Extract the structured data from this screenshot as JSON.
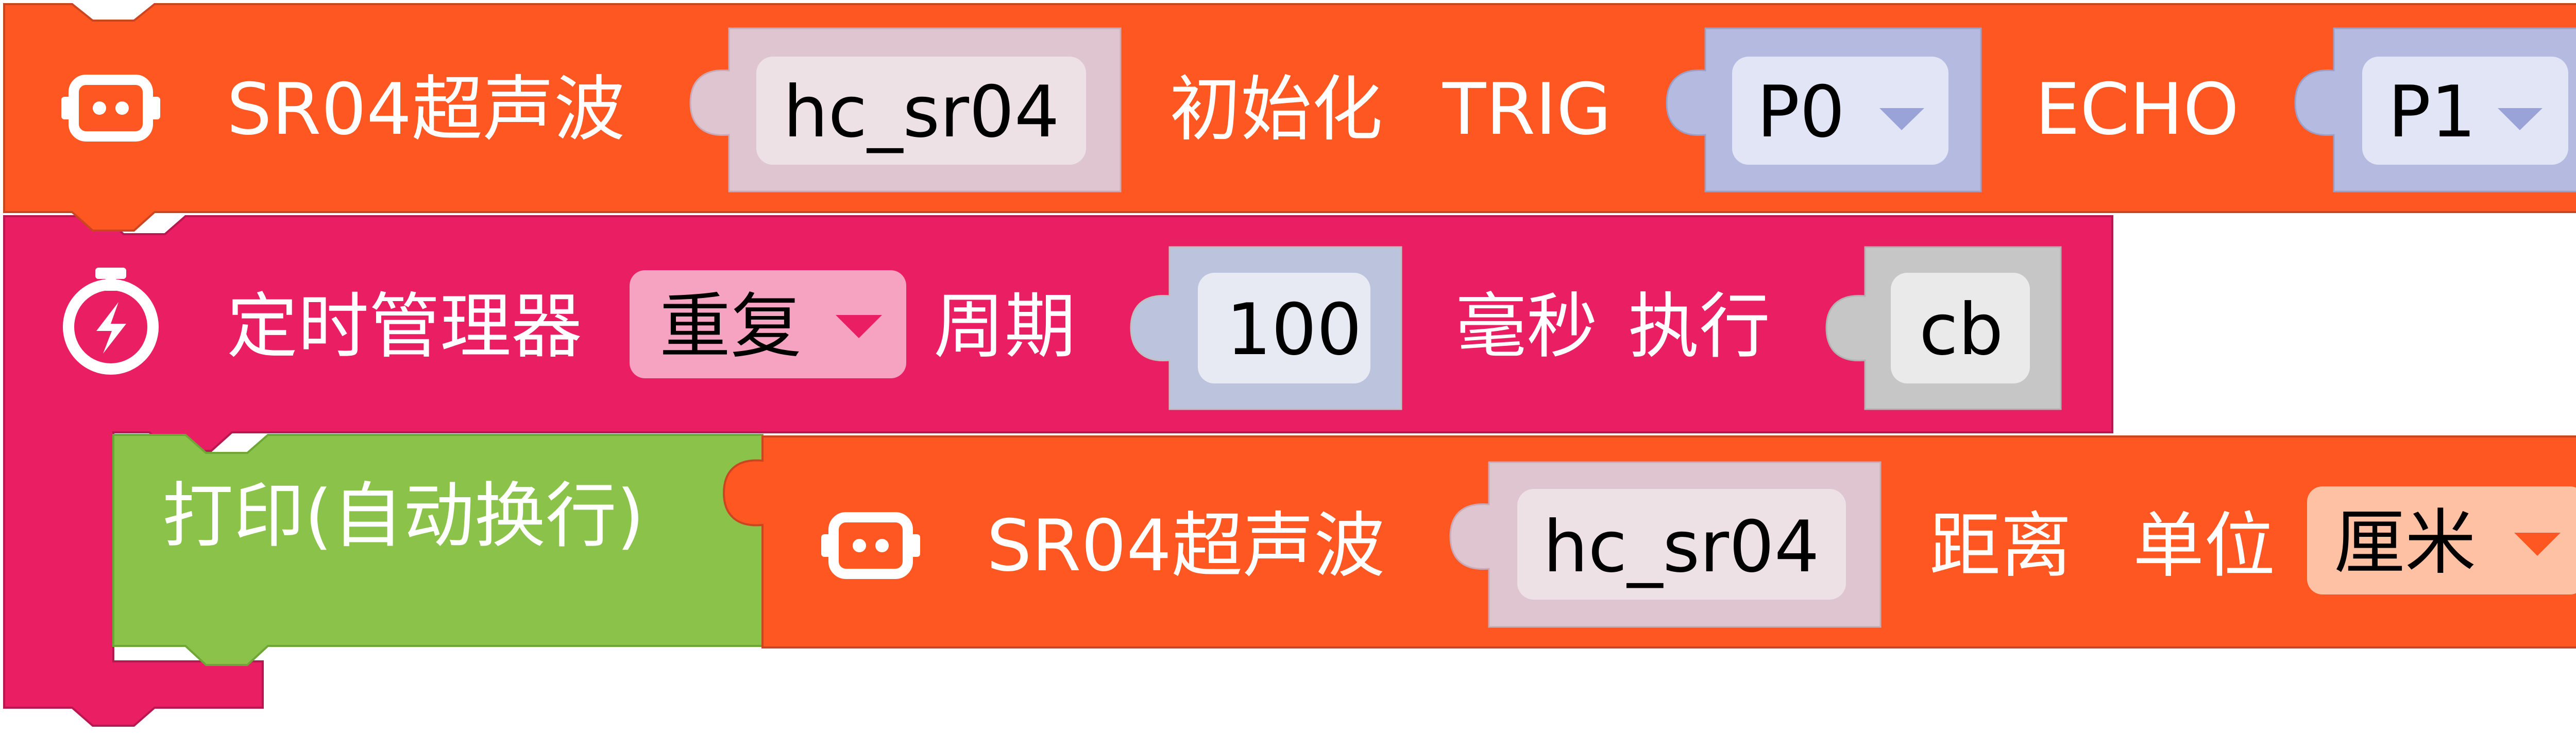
{
  "colors": {
    "sensor_block": "#ff5722",
    "sensor_block_edge": "#cc4521",
    "timer_block": "#e91e63",
    "timer_block_edge": "#ba1750",
    "print_block": "#8bc34a",
    "print_block_edge": "#6ea637",
    "name_socket": "#dec5cf",
    "name_field": "#ede1e6",
    "pin_socket": "#b5bbe0",
    "pin_field": "#e1e5f5",
    "number_socket": "#bcc4dd",
    "number_field": "#e7eaf3",
    "callback_socket": "#c6c6c6",
    "callback_field": "#eaeaea",
    "mode_dropdown": "#f5a3c0",
    "unit_dropdown": "#ffc1a3",
    "dropdown_arrow": "#9aa3d8"
  },
  "init_block": {
    "icon": "robot-icon",
    "label": "SR04超声波",
    "name": "hc_sr04",
    "init_label": "初始化",
    "trig_label": "TRIG",
    "trig_pin": "P0",
    "echo_label": "ECHO",
    "echo_pin": "P1"
  },
  "timer_block": {
    "icon": "stopwatch-icon",
    "label": "定时管理器",
    "mode": "重复",
    "period_label": "周期",
    "period": "100",
    "unit_label": "毫秒",
    "run_label": "执行",
    "callback": "cb"
  },
  "print_block": {
    "label": "打印(自动换行)"
  },
  "distance_block": {
    "icon": "robot-icon",
    "label": "SR04超声波",
    "name": "hc_sr04",
    "distance_label": "距离",
    "unit_label": "单位",
    "unit": "厘米"
  }
}
